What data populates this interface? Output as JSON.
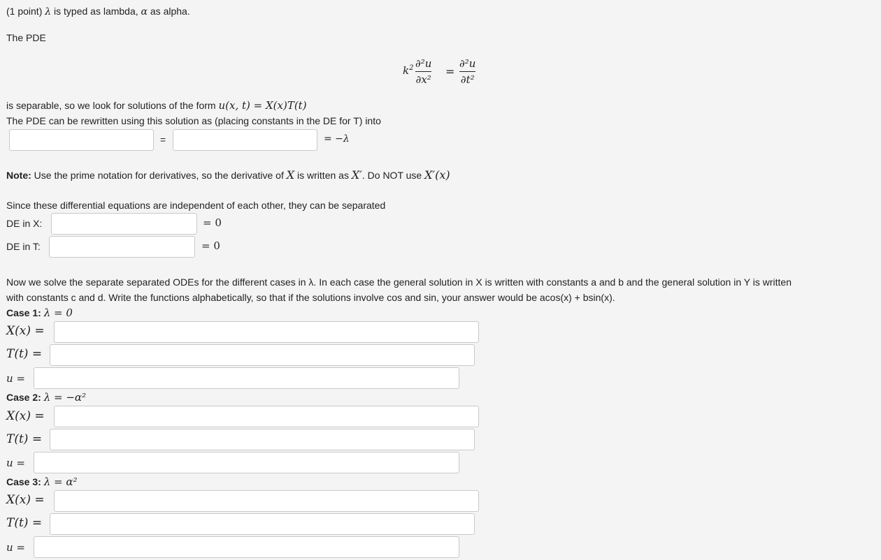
{
  "header": {
    "points": "(1 point)",
    "lambda_symbol": "λ",
    "lambda_note": "is typed as lambda,",
    "alpha_symbol": "α",
    "alpha_note": "as alpha."
  },
  "pde": {
    "intro": "The PDE",
    "coef": "k",
    "coef_power": "2",
    "lhs_num": "∂²u",
    "lhs_den": "∂x²",
    "equals": "=",
    "rhs_num": "∂²u",
    "rhs_den": "∂t²"
  },
  "separable": {
    "text": "is separable, so we look for solutions of the form",
    "form": "u(x, t) = X(x)T(t)"
  },
  "rewrite": {
    "text": "The PDE can be rewritten using this solution as (placing constants in the DE for T) into",
    "equals": "=",
    "tail": "= −λ",
    "left_value": "",
    "right_value": ""
  },
  "note": {
    "label": "Note:",
    "text1": "Use the prime notation for derivatives, so the derivative of",
    "X": "X",
    "text2": "is written as",
    "Xprime": "X′",
    "text3": ". Do NOT use",
    "Xprime_x": "X′(x)"
  },
  "separated": {
    "text": "Since these differential equations are independent of each other, they can be separated",
    "de_x_label": "DE in X:",
    "de_t_label": "DE in T:",
    "equals_zero": "= 0",
    "de_x_value": "",
    "de_t_value": ""
  },
  "instructions": {
    "line1": "Now we solve the separate separated ODEs for the different cases in λ. In each case the general solution in X is written with constants a and b and the general solution in Y is written",
    "line2": "with constants c and d. Write the functions alphabetically, so that if the solutions involve cos and sin, your answer would be acos(x) + bsin(x)."
  },
  "cases": [
    {
      "label": "Case 1:",
      "condition": "λ = 0",
      "X_label": "X(x) =",
      "T_label": "T(t) =",
      "u_label": "u =",
      "X_value": "",
      "T_value": "",
      "u_value": ""
    },
    {
      "label": "Case 2:",
      "condition": "λ = −α²",
      "X_label": "X(x) =",
      "T_label": "T(t) =",
      "u_label": "u =",
      "X_value": "",
      "T_value": "",
      "u_value": ""
    },
    {
      "label": "Case 3:",
      "condition": "λ = α²",
      "X_label": "X(x) =",
      "T_label": "T(t) =",
      "u_label": "u =",
      "X_value": "",
      "T_value": "",
      "u_value": ""
    }
  ]
}
